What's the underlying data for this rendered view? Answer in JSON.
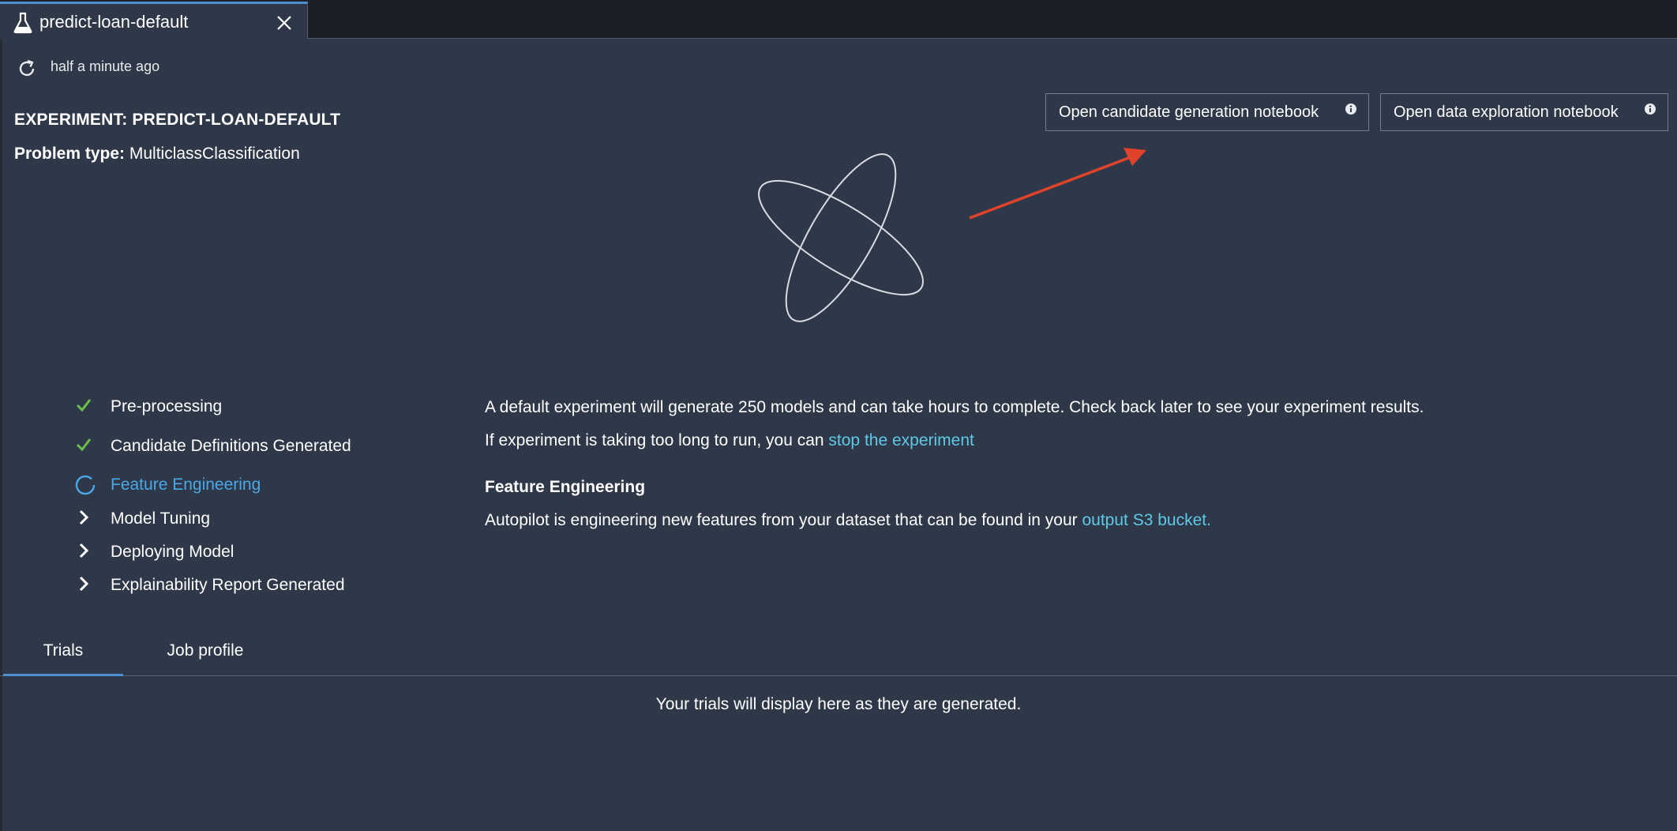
{
  "tab": {
    "title": "predict-loan-default",
    "icon": "flask-icon",
    "close_icon": "close-icon"
  },
  "refresh": {
    "icon": "refresh-icon",
    "time": "half a minute ago"
  },
  "experiment": {
    "title": "EXPERIMENT: PREDICT-LOAN-DEFAULT",
    "problem_type_label": "Problem type:",
    "problem_type_value": "MulticlassClassification"
  },
  "buttons": {
    "candidate_notebook": "Open candidate generation notebook",
    "exploration_notebook": "Open data exploration notebook",
    "info_icon": "info-icon"
  },
  "steps": [
    {
      "label": "Pre-processing",
      "state": "done",
      "icon": "check-icon"
    },
    {
      "label": "Candidate Definitions Generated",
      "state": "done",
      "icon": "check-icon"
    },
    {
      "label": "Feature Engineering",
      "state": "in-progress",
      "icon": "spinner-icon"
    },
    {
      "label": "Model Tuning",
      "state": "pending",
      "icon": "chevron-right-icon"
    },
    {
      "label": "Deploying Model",
      "state": "pending",
      "icon": "chevron-right-icon"
    },
    {
      "label": "Explainability Report Generated",
      "state": "pending",
      "icon": "chevron-right-icon"
    }
  ],
  "message": {
    "line1": "A default experiment will generate 250 models and can take hours to complete. Check back later to see your experiment results.",
    "line2_prefix": "If experiment is taking too long to run, you can ",
    "line2_link": "stop the experiment",
    "section_title": "Feature Engineering",
    "line3_prefix": "Autopilot is engineering new features from your dataset that can be found in your ",
    "line3_link": "output S3 bucket."
  },
  "bottom_tabs": [
    {
      "label": "Trials",
      "selected": true
    },
    {
      "label": "Job profile",
      "selected": false
    }
  ],
  "empty_note": "Your trials will display here as they are generated.",
  "colors": {
    "background": "#2f3848",
    "tabbar": "#1b1f26",
    "accent_blue": "#4a8fd0",
    "active_step": "#4aa8e8",
    "link": "#5fc9e8",
    "check_green": "#6cc04a",
    "annotation_arrow": "#e0432b"
  }
}
